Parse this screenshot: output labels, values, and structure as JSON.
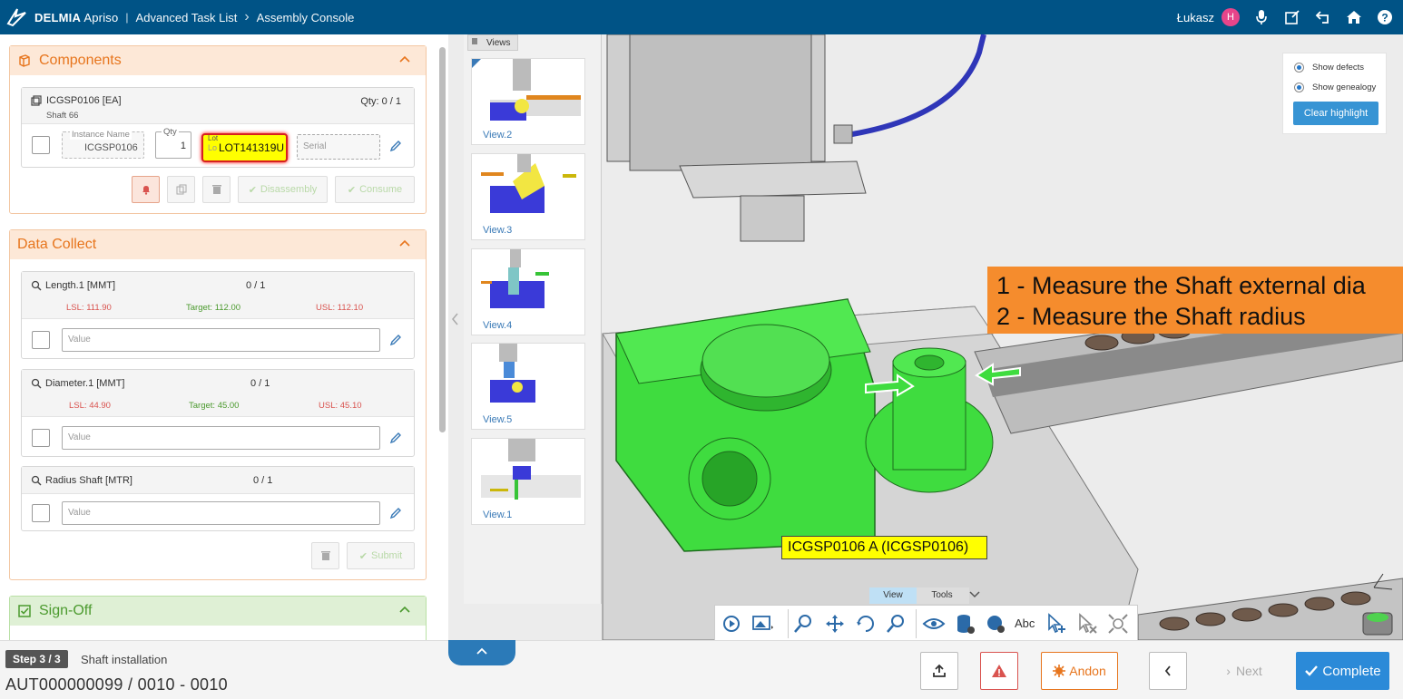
{
  "header": {
    "brand_bold": "DELMIA",
    "brand_light": "Apriso",
    "sep": "|",
    "crumb1": "Advanced Task List",
    "crumb2": "Assembly Console",
    "crumb_arrow": "›",
    "user": "Łukasz",
    "avatar_letter": "H"
  },
  "components": {
    "title": "Components",
    "item_code": "ICGSP0106 [EA]",
    "item_desc": "Shaft 66",
    "qty": "Qty: 0 / 1",
    "instance_label": "Instance Name",
    "instance_value": "ICGSP0106",
    "qty_label": "Qty",
    "qty_value": "1",
    "lot_label": "Lot",
    "lot_prefix": "Lo",
    "lot_value": "LOT141319U",
    "serial_placeholder": "Serial",
    "disassembly": "Disassembly",
    "consume": "Consume"
  },
  "data_collect": {
    "title": "Data Collect",
    "items": [
      {
        "name": "Length.1 [MMT]",
        "count": "0 / 1",
        "lsl_l": "LSL:",
        "lsl": "111.90",
        "target_l": "Target:",
        "target": "112.00",
        "usl_l": "USL:",
        "usl": "112.10",
        "placeholder": "Value"
      },
      {
        "name": "Diameter.1 [MMT]",
        "count": "0 / 1",
        "lsl_l": "LSL:",
        "lsl": "44.90",
        "target_l": "Target:",
        "target": "45.00",
        "usl_l": "USL:",
        "usl": "45.10",
        "placeholder": "Value"
      },
      {
        "name": "Radius Shaft [MTR]",
        "count": "0 / 1",
        "placeholder": "Value"
      }
    ],
    "submit": "Submit"
  },
  "signoff": {
    "title": "Sign-Off"
  },
  "footer": {
    "step": "Step 3 / 3",
    "step_name": "Shaft installation",
    "order": "AUT000000099 / 0010 - 0010",
    "andon": "Andon",
    "next": "Next",
    "complete": "Complete"
  },
  "viewer": {
    "views_tab": "Views",
    "views": [
      "View.2",
      "View.3",
      "View.4",
      "View.5",
      "View.1"
    ],
    "show_defects": "Show defects",
    "show_genealogy": "Show genealogy",
    "clear_highlight": "Clear highlight",
    "instruction1": "1 - Measure the Shaft external dia",
    "instruction2": "2 - Measure the Shaft radius",
    "part_label": "ICGSP0106 A (ICGSP0106)",
    "tab_view": "View",
    "tab_tools": "Tools",
    "abc": "Abc"
  },
  "colors": {
    "header": "#005386",
    "accent": "#e7751d",
    "complete": "#2b8ad8",
    "green_part": "#3fdc3f"
  }
}
